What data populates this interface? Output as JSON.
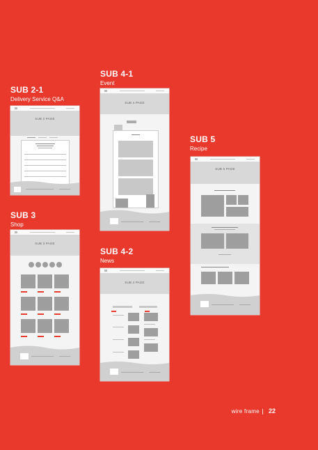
{
  "sections": {
    "sub21": {
      "title": "SUB 2-1",
      "subtitle": "Delivery Service Q&A",
      "page": "SUB 2 PAGE"
    },
    "sub3": {
      "title": "SUB 3",
      "subtitle": "Shop",
      "page": "SUB 3 PAGE"
    },
    "sub41": {
      "title": "SUB 4-1",
      "subtitle": "Event",
      "page": "SUB 4 PAGE"
    },
    "sub42": {
      "title": "SUB 4-2",
      "subtitle": "News",
      "page": "SUB 4 PAGE"
    },
    "sub5": {
      "title": "SUB 5",
      "subtitle": "Recipe",
      "page": "SUB 5 PAGE"
    }
  },
  "footer": {
    "label": "wire frame",
    "page_number": "22"
  },
  "colors": {
    "background": "#e8392c",
    "wire_dark": "#9e9e9e",
    "wire_light": "#d8d8d8"
  }
}
